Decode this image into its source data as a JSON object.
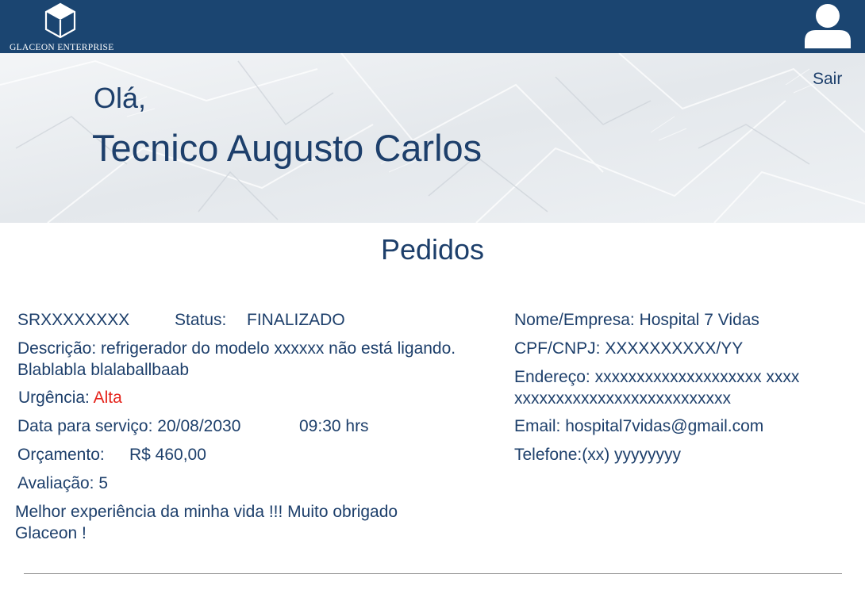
{
  "header": {
    "logo_text": "GLACEON ENTERPRISE",
    "avatar_icon": "user-avatar-icon"
  },
  "hero": {
    "greeting": "Olá,",
    "user_name": "Tecnico Augusto Carlos",
    "logout_label": "Sair"
  },
  "section": {
    "title": "Pedidos"
  },
  "order": {
    "id": "SRXXXXXXXX",
    "status_label": "Status:",
    "status_value": "FINALIZADO",
    "description_label": "Descrição:",
    "description_value": "refrigerador do modelo xxxxxx não está ligando. Blablabla blalaballbaab",
    "urgency_label": "Urgência:",
    "urgency_value": "Alta",
    "date_label": "Data para serviço:",
    "date_value": "20/08/2030",
    "time_value": "09:30 hrs",
    "budget_label": "Orçamento:",
    "budget_value": "R$ 460,00",
    "rating_label": "Avaliação:",
    "rating_value": "5",
    "comment": "Melhor experiência da minha vida !!! Muito obrigado Glaceon !"
  },
  "client": {
    "name_label": "Nome/Empresa:",
    "name_value": "Hospital 7 Vidas",
    "doc_label": "CPF/CNPJ:",
    "doc_value": "XXXXXXXXXX/YY",
    "address_label": "Endereço:",
    "address_value": "xxxxxxxxxxxxxxxxxxxx xxxxxxxxxxxxxxxxxxxxxxxxxxxxxx",
    "email_label": "Email:",
    "email_value": "hospital7vidas@gmail.com",
    "phone_label": "Telefone:",
    "phone_value": "(xx) yyyyyyyy"
  },
  "colors": {
    "header_bg": "#1b4571",
    "primary_text": "#1d3f6b",
    "urgency_high": "#e5231b"
  }
}
